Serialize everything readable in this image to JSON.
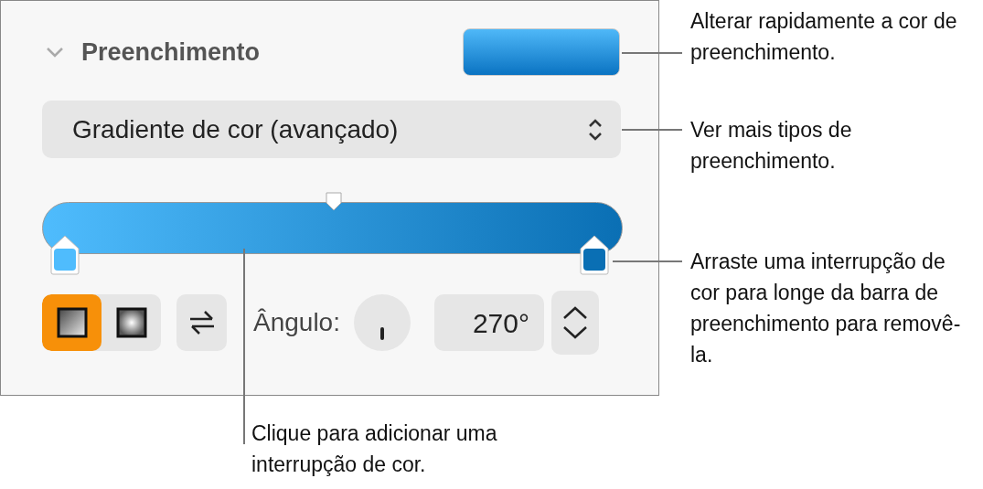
{
  "panel": {
    "title": "Preenchimento",
    "expanded": true,
    "fill_type": "Gradiente de cor (avançado)",
    "gradient_stops": [
      {
        "color": "#4fbcfd"
      },
      {
        "color": "#0a6fb4"
      }
    ],
    "gradient_types": [
      {
        "kind": "linear",
        "selected": true
      },
      {
        "kind": "radial",
        "selected": false
      }
    ],
    "angle_label": "Ângulo:",
    "angle_value": "270°"
  },
  "callouts": [
    {
      "text": "Alterar rapidamente a cor de preenchimento."
    },
    {
      "text": "Ver mais tipos de preenchimento."
    },
    {
      "text": "Arraste uma interrupção de cor para longe da barra de preenchimento para removê-la."
    },
    {
      "text": "Clique para adicionar uma interrupção de cor."
    }
  ]
}
